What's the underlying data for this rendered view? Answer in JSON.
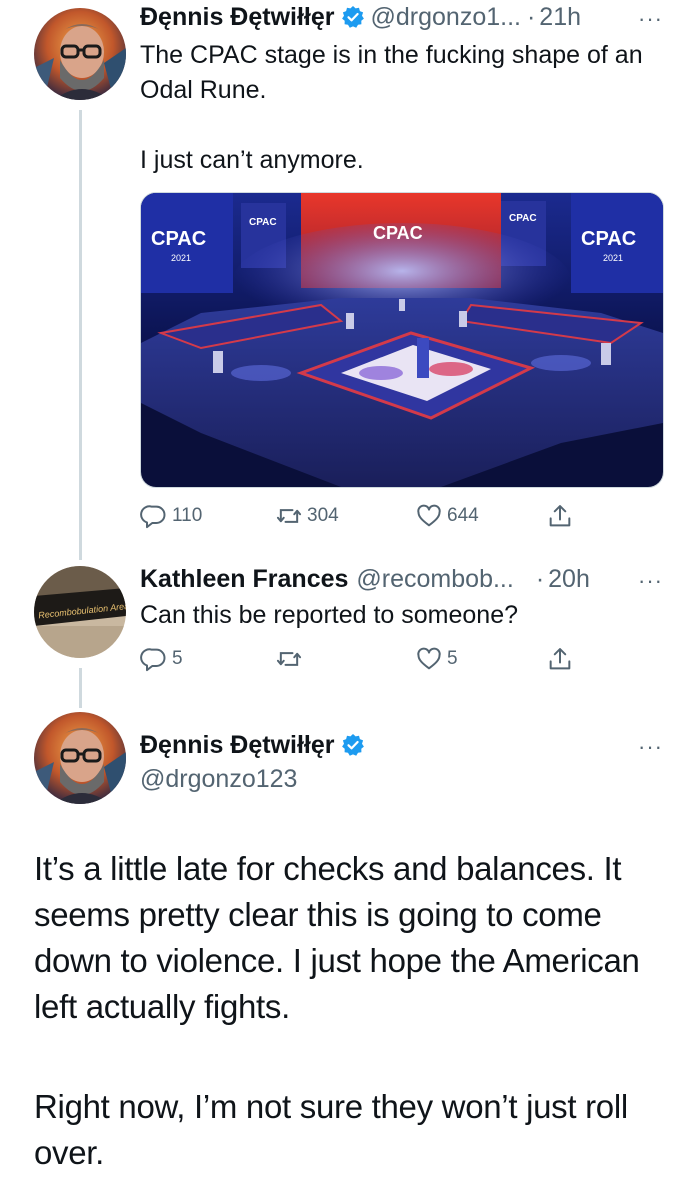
{
  "tweet1": {
    "name": "Đęnnis Đętwiłłęr",
    "handle": "@drgonzo1...",
    "dot": "·",
    "time": "21h",
    "more": "···",
    "text": "The CPAC stage is in the fucking shape of an Odal Rune.\n\nI just can’t anymore.",
    "media": {
      "logo": "CPAC",
      "year": "2021"
    },
    "stats": {
      "replies": "110",
      "retweets": "304",
      "likes": "644"
    }
  },
  "tweet2": {
    "name": "Kathleen Frances",
    "handle": "@recombob...",
    "dot": "·",
    "time": "20h",
    "more": "···",
    "text": "Can this be reported to someone?",
    "avatar_sign": "Recombobulation Area",
    "stats": {
      "replies": "5",
      "retweets": "",
      "likes": "5"
    }
  },
  "tweet3": {
    "name": "Đęnnis Đętwiłłęr",
    "handle": "@drgonzo123",
    "more": "···",
    "paragraph1": "It’s a little late for checks and balances. It seems pretty clear this is going to come down to violence. I just hope the American left actually fights.",
    "paragraph2": "Right now, I’m not sure they won’t just roll over."
  },
  "colors": {
    "verified": "#1d9bf0",
    "secondary_text": "#536471",
    "thread_line": "#cfd9de"
  },
  "icons": [
    "verified-badge-icon",
    "more-icon",
    "reply-icon",
    "retweet-icon",
    "like-icon",
    "share-icon"
  ]
}
